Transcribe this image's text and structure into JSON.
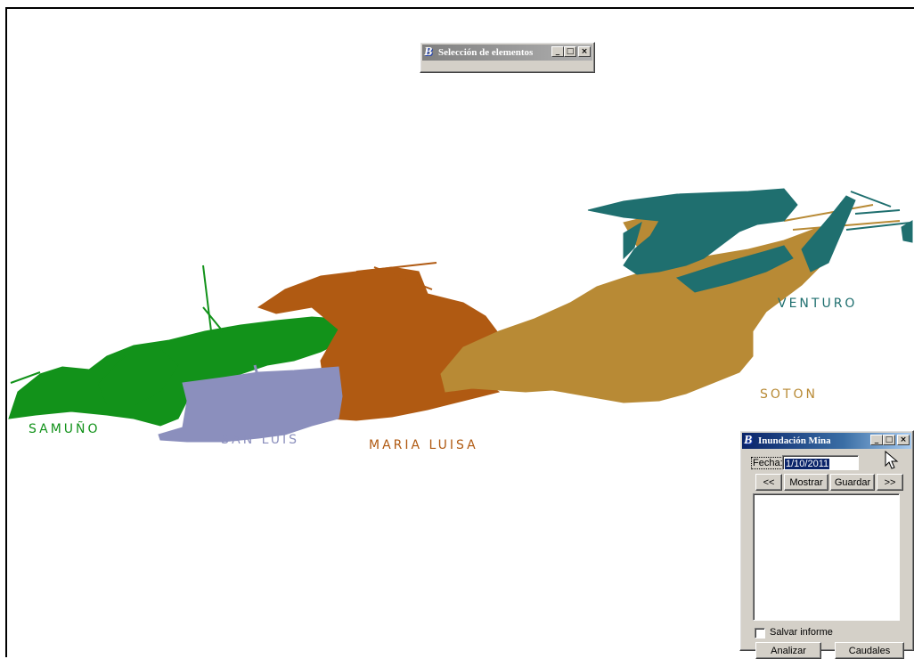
{
  "map": {
    "labels": {
      "samuno": "SAMUÑO",
      "san_luis": "SAN LUIS",
      "maria_luisa": "MARIA LUISA",
      "venturo": "VENTURO",
      "soton": "SOTON"
    },
    "colors": {
      "samuno": "#12921a",
      "san_luis": "#8b8fbd",
      "maria_luisa": "#b05a12",
      "venturo": "#1f6f6f",
      "soton": "#b88a35"
    }
  },
  "selection_window": {
    "title": "Selección de elementos",
    "icon": "bentley-b-icon"
  },
  "flood_window": {
    "title": "Inundación Mina",
    "icon": "bentley-b-icon",
    "date_label": "Fecha:",
    "date_value": "1/10/2011",
    "prev_label": "<<",
    "show_label": "Mostrar",
    "save_label": "Guardar",
    "next_label": ">>",
    "save_report_label": "Salvar informe",
    "save_report_checked": false,
    "analyze_label": "Analizar",
    "flows_label": "Caudales"
  }
}
